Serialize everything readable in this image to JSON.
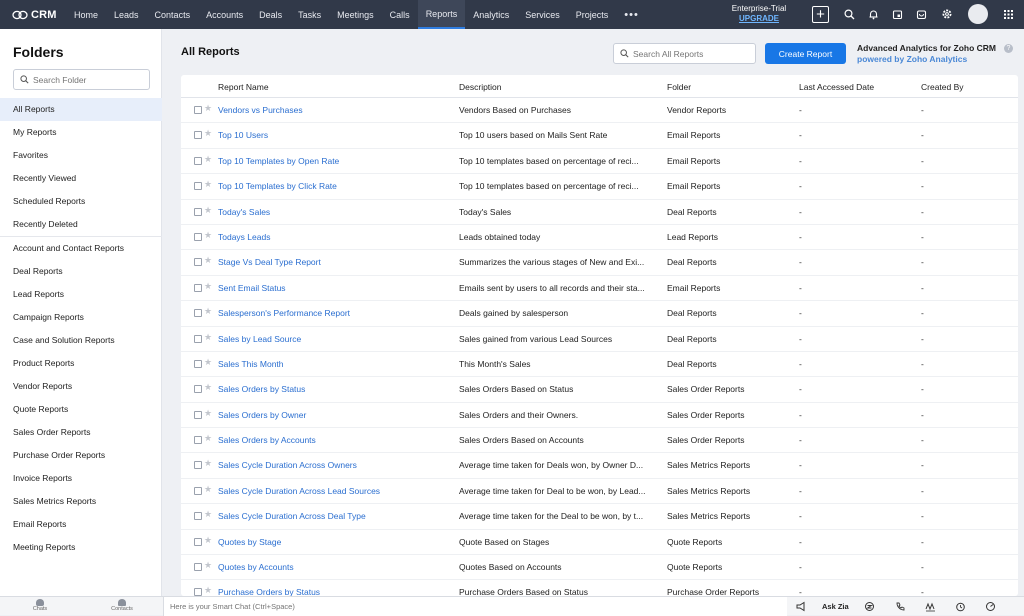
{
  "app": {
    "name": "CRM"
  },
  "nav": {
    "tabs": [
      {
        "label": "Home"
      },
      {
        "label": "Leads"
      },
      {
        "label": "Contacts"
      },
      {
        "label": "Accounts"
      },
      {
        "label": "Deals"
      },
      {
        "label": "Tasks"
      },
      {
        "label": "Meetings"
      },
      {
        "label": "Calls"
      },
      {
        "label": "Reports"
      },
      {
        "label": "Analytics"
      },
      {
        "label": "Services"
      },
      {
        "label": "Projects"
      }
    ],
    "active_tab": "Reports",
    "more_label": "•••",
    "trial_label": "Enterprise-Trial",
    "upgrade_label": "UPGRADE",
    "icons": [
      "plus-icon",
      "search-icon",
      "bell-icon",
      "calendar-icon",
      "store-icon",
      "gear-icon",
      "avatar",
      "apps-grid-icon"
    ]
  },
  "sidebar": {
    "title": "Folders",
    "search_placeholder": "Search Folder",
    "items": [
      {
        "label": "All Reports",
        "active": true
      },
      {
        "label": "My Reports"
      },
      {
        "label": "Favorites"
      },
      {
        "label": "Recently Viewed"
      },
      {
        "label": "Scheduled Reports"
      },
      {
        "label": "Recently Deleted"
      },
      {
        "label": "Account and Contact Reports"
      },
      {
        "label": "Deal Reports"
      },
      {
        "label": "Lead Reports"
      },
      {
        "label": "Campaign Reports"
      },
      {
        "label": "Case and Solution Reports"
      },
      {
        "label": "Product Reports"
      },
      {
        "label": "Vendor Reports"
      },
      {
        "label": "Quote Reports"
      },
      {
        "label": "Sales Order Reports"
      },
      {
        "label": "Purchase Order Reports"
      },
      {
        "label": "Invoice Reports"
      },
      {
        "label": "Sales Metrics Reports"
      },
      {
        "label": "Email Reports"
      },
      {
        "label": "Meeting Reports"
      }
    ]
  },
  "main": {
    "title": "All Reports",
    "search_placeholder": "Search All Reports",
    "create_button": "Create Report",
    "promo_title": "Advanced Analytics for Zoho CRM",
    "promo_sub": "powered by Zoho Analytics",
    "help": "?",
    "columns": [
      "Report Name",
      "Description",
      "Folder",
      "Last Accessed Date",
      "Created By"
    ],
    "rows": [
      {
        "name": "Vendors vs Purchases",
        "desc": "Vendors Based on Purchases",
        "folder": "Vendor Reports",
        "last": "-",
        "by": "-"
      },
      {
        "name": "Top 10 Users",
        "desc": "Top 10 users based on Mails Sent Rate",
        "folder": "Email Reports",
        "last": "-",
        "by": "-"
      },
      {
        "name": "Top 10 Templates by Open Rate",
        "desc": "Top 10 templates based on percentage of reci...",
        "folder": "Email Reports",
        "last": "-",
        "by": "-"
      },
      {
        "name": "Top 10 Templates by Click Rate",
        "desc": "Top 10 templates based on percentage of reci...",
        "folder": "Email Reports",
        "last": "-",
        "by": "-"
      },
      {
        "name": "Today's Sales",
        "desc": "Today's Sales",
        "folder": "Deal Reports",
        "last": "-",
        "by": "-"
      },
      {
        "name": "Todays Leads",
        "desc": "Leads obtained today",
        "folder": "Lead Reports",
        "last": "-",
        "by": "-"
      },
      {
        "name": "Stage Vs Deal Type Report",
        "desc": "Summarizes the various stages of New and Exi...",
        "folder": "Deal Reports",
        "last": "-",
        "by": "-"
      },
      {
        "name": "Sent Email Status",
        "desc": "Emails sent by users to all records and their sta...",
        "folder": "Email Reports",
        "last": "-",
        "by": "-"
      },
      {
        "name": "Salesperson's Performance Report",
        "desc": "Deals gained by salesperson",
        "folder": "Deal Reports",
        "last": "-",
        "by": "-"
      },
      {
        "name": "Sales by Lead Source",
        "desc": "Sales gained from various Lead Sources",
        "folder": "Deal Reports",
        "last": "-",
        "by": "-"
      },
      {
        "name": "Sales This Month",
        "desc": "This Month's Sales",
        "folder": "Deal Reports",
        "last": "-",
        "by": "-"
      },
      {
        "name": "Sales Orders by Status",
        "desc": "Sales Orders Based on Status",
        "folder": "Sales Order Reports",
        "last": "-",
        "by": "-"
      },
      {
        "name": "Sales Orders by Owner",
        "desc": "Sales Orders and their Owners.",
        "folder": "Sales Order Reports",
        "last": "-",
        "by": "-"
      },
      {
        "name": "Sales Orders by Accounts",
        "desc": "Sales Orders Based on Accounts",
        "folder": "Sales Order Reports",
        "last": "-",
        "by": "-"
      },
      {
        "name": "Sales Cycle Duration Across Owners",
        "desc": "Average time taken for Deals won, by Owner D...",
        "folder": "Sales Metrics Reports",
        "last": "-",
        "by": "-"
      },
      {
        "name": "Sales Cycle Duration Across Lead Sources",
        "desc": "Average time taken for Deal to be won, by Lead...",
        "folder": "Sales Metrics Reports",
        "last": "-",
        "by": "-"
      },
      {
        "name": "Sales Cycle Duration Across Deal Type",
        "desc": "Average time taken for the Deal to be won, by t...",
        "folder": "Sales Metrics Reports",
        "last": "-",
        "by": "-"
      },
      {
        "name": "Quotes by Stage",
        "desc": "Quote Based on Stages",
        "folder": "Quote Reports",
        "last": "-",
        "by": "-"
      },
      {
        "name": "Quotes by Accounts",
        "desc": "Quotes Based on Accounts",
        "folder": "Quote Reports",
        "last": "-",
        "by": "-"
      },
      {
        "name": "Purchase Orders by Status",
        "desc": "Purchase Orders Based on Status",
        "folder": "Purchase Order Reports",
        "last": "-",
        "by": "-"
      }
    ]
  },
  "bottom": {
    "chats_label": "Chats",
    "contacts_label": "Contacts",
    "smart_chat_placeholder": "Here is your Smart Chat (Ctrl+Space)",
    "ask_zia": "Ask Zia"
  }
}
